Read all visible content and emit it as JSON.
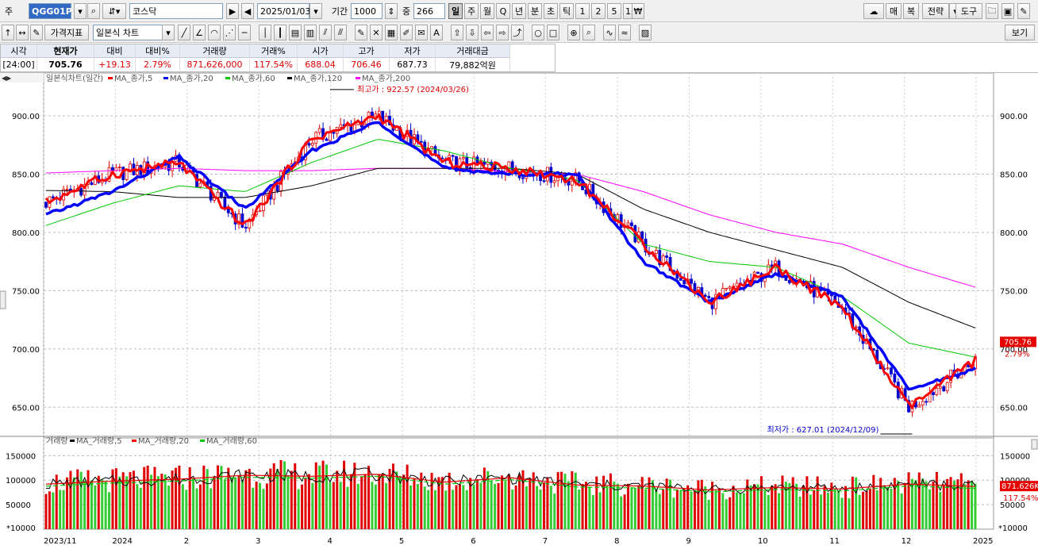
{
  "toolbar1": {
    "market_label": "주",
    "code": "QGG01P",
    "market_name": "코스닥",
    "date": "2025/01/03",
    "period_label": "기간",
    "period_value": "1000",
    "count_label": "중",
    "count_value": "266",
    "intervals": [
      "일",
      "주",
      "월",
      "Q",
      "년",
      "분",
      "초",
      "틱",
      "1",
      "2",
      "5",
      "15"
    ],
    "active_interval": "일",
    "right_buttons": [
      "매",
      "복",
      "전략",
      "도구"
    ]
  },
  "toolbar2": {
    "indicator_button": "가격지표",
    "chart_type": "일본식 차트",
    "view_button": "보기"
  },
  "quote": {
    "headers": [
      "시각",
      "현재가",
      "대비",
      "대비%",
      "거래량",
      "거래%",
      "시가",
      "고가",
      "저가",
      "거래대금"
    ],
    "values": [
      "[24:00]",
      "705.76",
      "+19.13",
      "2.79%",
      "871,626,000",
      "117.54%",
      "688.04",
      "706.46",
      "687.73",
      "79,882억원"
    ]
  },
  "price_panel": {
    "legend": [
      "일본식차트(일간)",
      "MA_종가,5",
      "MA_종가,20",
      "MA_종가,60",
      "MA_종가,120",
      "MA_종가,200"
    ],
    "legend_colors": [
      "#000000",
      "#ff0000",
      "#0000ff",
      "#00c800",
      "#000000",
      "#ff00ff"
    ],
    "y_ticks": [
      "900.00",
      "850.00",
      "800.00",
      "750.00",
      "700.00",
      "650.00"
    ],
    "high_annotation": "최고가 : 922.57 (2024/03/26)",
    "low_annotation": "최저가 : 627.01 (2024/12/09)",
    "last_price_tag": "705.76",
    "last_change_tag": "2.79%"
  },
  "volume_panel": {
    "legend": [
      "거래량",
      "MA_거래량,5",
      "MA_거래량,20",
      "MA_거래량,60"
    ],
    "legend_colors": [
      "#ff0000",
      "#000000",
      "#ff0000",
      "#00c800"
    ],
    "y_ticks": [
      "150000",
      "100000",
      "50000"
    ],
    "unit_label": "*10000",
    "last_volume_tag": "871.626K",
    "last_pct_tag": "117.54%"
  },
  "x_axis": [
    "2023/11",
    "2024",
    "2",
    "3",
    "4",
    "5",
    "6",
    "7",
    "8",
    "9",
    "10",
    "11",
    "12",
    "2025"
  ],
  "chart_data": {
    "type": "line",
    "title": "일본식차트(일간)",
    "x": [
      "2023/11",
      "2023/12",
      "2024/01",
      "2024/02",
      "2024/03",
      "2024/04",
      "2024/05",
      "2024/06",
      "2024/07",
      "2024/08",
      "2024/09",
      "2024/10",
      "2024/11",
      "2024/12",
      "2025/01"
    ],
    "series": [
      {
        "name": "MA_종가,5",
        "color": "#ff0000",
        "values": [
          826,
          850,
          860,
          805,
          880,
          900,
          860,
          855,
          845,
          790,
          740,
          770,
          735,
          650,
          690
        ]
      },
      {
        "name": "MA_종가,20",
        "color": "#0000ff",
        "values": [
          815,
          835,
          865,
          820,
          870,
          895,
          855,
          850,
          850,
          775,
          740,
          765,
          745,
          665,
          683
        ]
      },
      {
        "name": "MA_종가,60",
        "color": "#00c800",
        "values": [
          806,
          825,
          840,
          835,
          860,
          880,
          870,
          855,
          845,
          790,
          775,
          770,
          745,
          705,
          693
        ]
      },
      {
        "name": "MA_종가,120",
        "color": "#000000",
        "values": [
          836,
          835,
          830,
          830,
          840,
          855,
          855,
          855,
          850,
          820,
          800,
          785,
          770,
          740,
          718
        ]
      },
      {
        "name": "MA_종가,200",
        "color": "#ff00ff",
        "values": [
          851,
          853,
          855,
          853,
          853,
          855,
          855,
          852,
          850,
          835,
          815,
          800,
          790,
          770,
          753
        ]
      }
    ],
    "high": {
      "value": 922.57,
      "date": "2024/03/26"
    },
    "low": {
      "value": 627.01,
      "date": "2024/12/09"
    },
    "last": 705.76,
    "ylim": [
      625,
      930
    ],
    "grid": true,
    "volume": {
      "ylim": [
        0,
        170000
      ],
      "monthly_levels": [
        92000,
        98000,
        102000,
        110000,
        108000,
        112000,
        96000,
        105000,
        90000,
        88000,
        80000,
        85000,
        82000,
        92000,
        87163
      ]
    }
  }
}
